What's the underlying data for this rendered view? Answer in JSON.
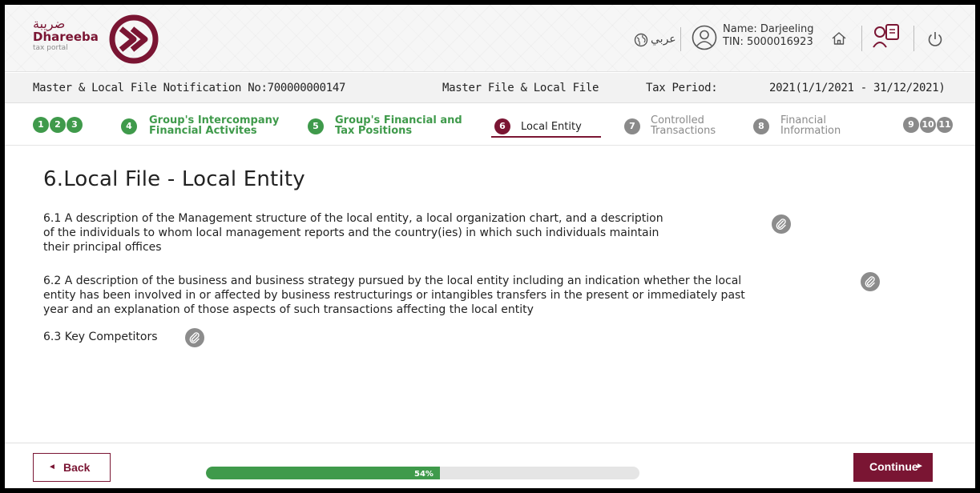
{
  "header": {
    "logo_arabic": "ضريبة",
    "logo_name": "Dhareeba",
    "logo_sub": "tax portal",
    "language_label": "عربي",
    "user_name": "Name: Darjeeling",
    "user_tin": "TIN: 5000016923"
  },
  "info": {
    "notification": "Master & Local File Notification No:700000000147",
    "type": "Master File & Local File",
    "period_label": "Tax Period:",
    "period_value": "2021(1/1/2021 - 31/12/2021)"
  },
  "steps": {
    "s1": "1",
    "s2": "2",
    "s3": "3",
    "s4_num": "4",
    "s4_line1": "Group's Intercompany",
    "s4_line2": "Financial Activites",
    "s5_num": "5",
    "s5_line1": "Group's Financial and",
    "s5_line2": "Tax Positions",
    "s6_num": "6",
    "s6_label": "Local Entity",
    "s7_num": "7",
    "s7_line1": "Controlled",
    "s7_line2": "Transactions",
    "s8_num": "8",
    "s8_line1": "Financial",
    "s8_line2": "Information",
    "s9": "9",
    "s10": "10",
    "s11": "11"
  },
  "main": {
    "title": "6.Local File - Local Entity",
    "item1_line1": "6.1 A description of the Management structure of the local entity, a local organization chart, and a description",
    "item1_line2": "of the individuals to whom local management reports and the country(ies) in which such individuals maintain",
    "item1_line3": "their principal offices",
    "item2_line1": "6.2 A description of the business and business strategy pursued by the local entity including an indication whether the local",
    "item2_line2": "entity has been involved in or affected by business restructurings or intangibles transfers in the present or immediately past",
    "item2_line3": "year and an explanation of those aspects of such transactions affecting the local entity",
    "item3": "6.3 Key Competitors"
  },
  "footer": {
    "back_label": "Back",
    "continue_label": "Continue",
    "progress_text": "54%",
    "progress_value": 0.54
  },
  "colors": {
    "brand": "#7a1533",
    "complete": "#3f9a4b",
    "pending": "#8a8a8a"
  },
  "icons": [
    "globe-icon",
    "user-icon",
    "home-icon",
    "documents-icon",
    "power-icon",
    "paperclip-icon"
  ]
}
